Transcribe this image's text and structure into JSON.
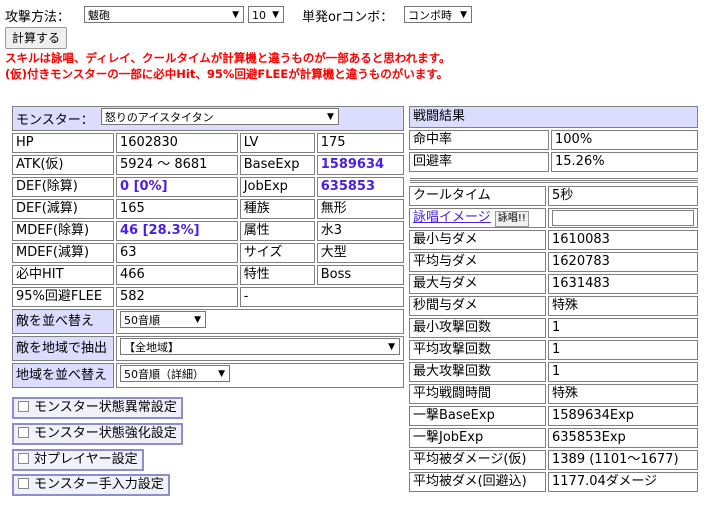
{
  "top": {
    "method_label": "攻撃方法：",
    "method_value": "魃砲",
    "level_value": "10",
    "mode_label": "単発orコンボ：",
    "mode_value": "コンボ時",
    "calc_button": "計算する",
    "warning1": "スキルは詠唱、ディレイ、クールタイムが計算機と違うものが一部あると思われます。",
    "warning2": "(仮)付きモンスターの一部に必中Hit、95%回避FLEEが計算機と違うものがいます。"
  },
  "monster": {
    "label": "モンスター：",
    "selected": "怒りのアイスタイタン",
    "rows": [
      {
        "k1": "HP",
        "v1": "1602830",
        "k2": "LV",
        "v2": "175"
      },
      {
        "k1": "ATK(仮)",
        "v1": "5924 ～ 8681",
        "k2": "BaseExp",
        "v2": "1589634"
      },
      {
        "k1": "DEF(除算)",
        "v1": "0 [0%]",
        "k2": "JobExp",
        "v2": "635853"
      },
      {
        "k1": "DEF(減算)",
        "v1": "165",
        "k2": "種族",
        "v2": "無形"
      },
      {
        "k1": "MDEF(除算)",
        "v1": "46 [28.3%]",
        "k2": "属性",
        "v2": "水3"
      },
      {
        "k1": "MDEF(減算)",
        "v1": "63",
        "k2": "サイズ",
        "v2": "大型"
      },
      {
        "k1": "必中HIT",
        "v1": "466",
        "k2": "特性",
        "v2": "Boss"
      },
      {
        "k1": "95%回避FLEE",
        "v1": "582",
        "k2": "-",
        "v2": ""
      }
    ],
    "sort_label": "敵を並べ替え",
    "sort_value": "50音順",
    "region_label": "敵を地域で抽出",
    "region_value": "【全地域】",
    "region_sort_label": "地域を並べ替え",
    "region_sort_value": "50音順（詳細）"
  },
  "settings": [
    "モンスター状態異常設定",
    "モンスター状態強化設定",
    "対プレイヤー設定",
    "モンスター手入力設定"
  ],
  "battle": {
    "title": "戦闘結果",
    "hit_label": "命中率",
    "hit_value": "100%",
    "flee_label": "回避率",
    "flee_value": "15.26%",
    "cooltime_label": "クールタイム",
    "cooltime_value": "5秒",
    "cast_image_link": "詠唱イメージ",
    "cast_button": "詠唱!!",
    "rows": [
      {
        "k": "最小与ダメ",
        "v": "1610083"
      },
      {
        "k": "平均与ダメ",
        "v": "1620783"
      },
      {
        "k": "最大与ダメ",
        "v": "1631483"
      },
      {
        "k": "秒間与ダメ",
        "v": "特殊"
      },
      {
        "k": "最小攻撃回数",
        "v": "1"
      },
      {
        "k": "平均攻撃回数",
        "v": "1"
      },
      {
        "k": "最大攻撃回数",
        "v": "1"
      },
      {
        "k": "平均戦闘時間",
        "v": "特殊"
      },
      {
        "k": "一撃BaseExp",
        "v": "1589634Exp"
      },
      {
        "k": "一撃JobExp",
        "v": "635853Exp"
      },
      {
        "k": "平均被ダメージ(仮)",
        "v": "1389 (1101～1677)"
      },
      {
        "k": "平均被ダメ(回避込)",
        "v": "1177.04ダメージ"
      }
    ]
  }
}
